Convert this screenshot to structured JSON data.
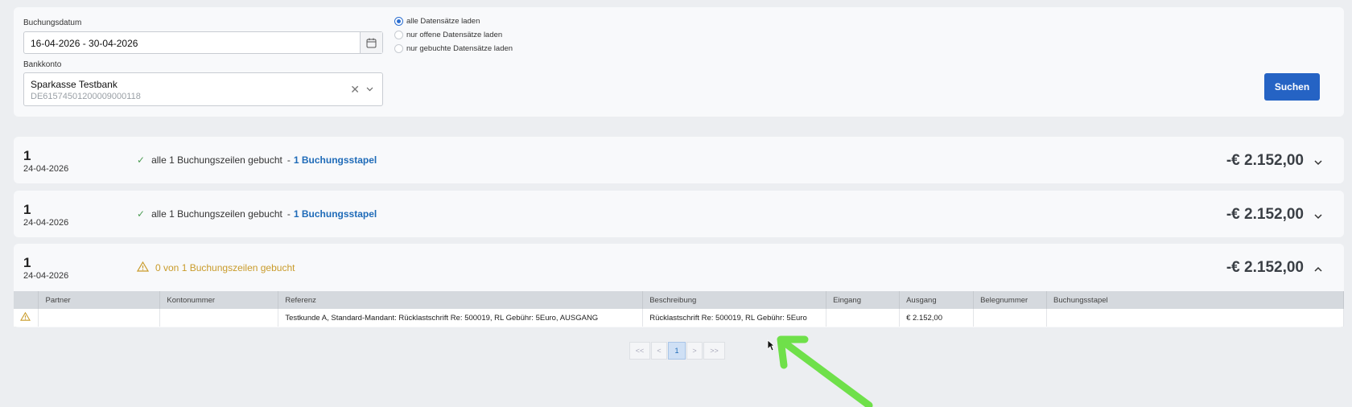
{
  "filters": {
    "booking_date_label": "Buchungsdatum",
    "booking_date_value": "16-04-2026 - 30-04-2026",
    "bank_account_label": "Bankkonto",
    "bank_name": "Sparkasse Testbank",
    "bank_iban": "DE61574501200009000118",
    "radio_options": [
      {
        "label": "alle Datensätze laden",
        "checked": true
      },
      {
        "label": "nur offene Datensätze laden",
        "checked": false
      },
      {
        "label": "nur gebuchte Datensätze laden",
        "checked": false
      }
    ],
    "search_label": "Suchen"
  },
  "batches": [
    {
      "count": "1",
      "date": "24-04-2026",
      "status": "alle 1 Buchungszeilen gebucht",
      "separator": "-",
      "link": "1 Buchungsstapel",
      "amount": "-€ 2.152,00"
    },
    {
      "count": "1",
      "date": "24-04-2026",
      "status": "alle 1 Buchungszeilen gebucht",
      "separator": "-",
      "link": "1 Buchungsstapel",
      "amount": "-€ 2.152,00"
    },
    {
      "count": "1",
      "date": "24-04-2026",
      "status": "0 von 1 Buchungszeilen gebucht",
      "amount": "-€ 2.152,00"
    }
  ],
  "table": {
    "headers": [
      "",
      "Partner",
      "Kontonummer",
      "Referenz",
      "Beschreibung",
      "Eingang",
      "Ausgang",
      "Belegnummer",
      "Buchungsstapel"
    ],
    "row": {
      "partner": "",
      "kontonummer": "",
      "referenz": "Testkunde A, Standard-Mandant: Rücklastschrift Re: 500019, RL Gebühr: 5Euro, AUSGANG",
      "beschreibung": "Rücklastschrift Re: 500019, RL Gebühr: 5Euro",
      "eingang": "",
      "ausgang": "€ 2.152,00",
      "belegnummer": "",
      "buchungsstapel": ""
    }
  },
  "pagination": {
    "first": "<<",
    "prev": "<",
    "current": "1",
    "next": ">",
    "last": ">>"
  },
  "colors": {
    "accent": "#2563c4",
    "link": "#1f6bb8",
    "success": "#4e9d55",
    "warning": "#c99b2a",
    "annotation_arrow": "#6fe04a"
  }
}
